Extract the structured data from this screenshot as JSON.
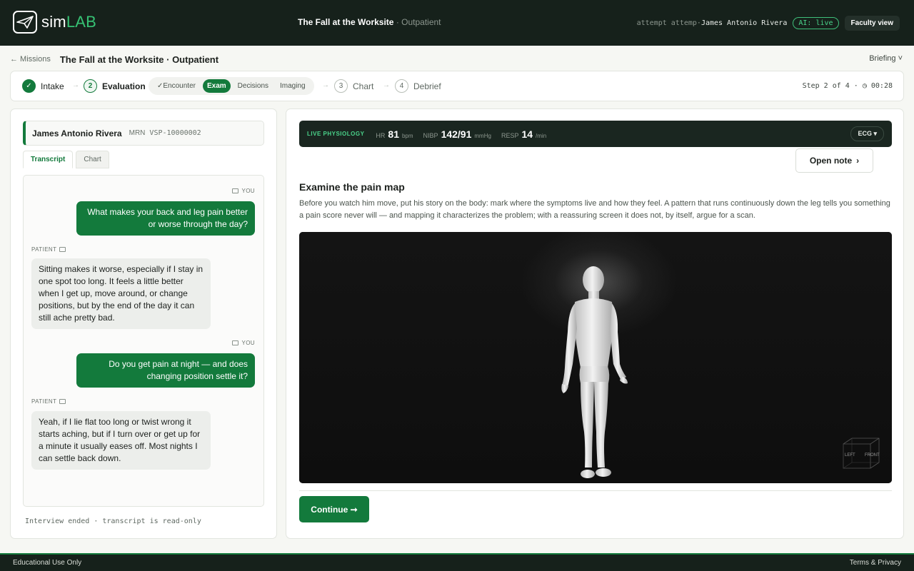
{
  "header": {
    "logo_text_a": "sim",
    "logo_text_b": "LAB",
    "mission_title": "The Fall at the Worksite",
    "mission_setting": " · Outpatient",
    "attempt_prefix": "attempt attemp·",
    "attempt_name": "James Antonio Rivera",
    "ai_badge": "AI: live",
    "faculty_button": "Faculty view"
  },
  "breadcrumb": {
    "back": "← Missions",
    "title": "The Fall at the Worksite · Outpatient",
    "briefing": "Briefing ˅"
  },
  "stepper": {
    "steps": [
      {
        "num": "✓",
        "label": "Intake",
        "state": "done"
      },
      {
        "num": "2",
        "label": "Evaluation",
        "state": "current"
      },
      {
        "num": "3",
        "label": "Chart",
        "state": "todo"
      },
      {
        "num": "4",
        "label": "Debrief",
        "state": "todo"
      }
    ],
    "arrow": "→",
    "subtabs": [
      "✓Encounter",
      "Exam",
      "Decisions",
      "Imaging"
    ],
    "active_subtab": "Exam",
    "step_info": "Step 2 of 4 · ◷ 00:28"
  },
  "patient": {
    "name": "James Antonio Rivera",
    "mrn_label": "MRN",
    "mrn": "VSP-10000002"
  },
  "left_tabs": [
    "Transcript",
    "Chart"
  ],
  "transcript": {
    "you_label": "YOU",
    "patient_label": "PATIENT",
    "messages": [
      {
        "speaker": "you",
        "text": "What makes your back and leg pain better or worse through the day?"
      },
      {
        "speaker": "patient",
        "text": "Sitting makes it worse, especially if I stay in one spot too long. It feels a little better when I get up, move around, or change positions, but by the end of the day it can still ache pretty bad."
      },
      {
        "speaker": "you",
        "text": "Do you get pain at night — and does changing position settle it?"
      },
      {
        "speaker": "patient",
        "text": "Yeah, if I lie flat too long or twist wrong it starts aching, but if I turn over or get up for a minute it usually eases off. Most nights I can settle back down."
      }
    ],
    "status": "Interview ended · transcript is read-only"
  },
  "vitals": {
    "live_label": "LIVE PHYSIOLOGY",
    "hr": {
      "label": "HR",
      "value": "81",
      "unit": "bpm"
    },
    "nibp": {
      "label": "NIBP",
      "value": "142/91",
      "unit": "mmHg"
    },
    "resp": {
      "label": "RESP",
      "value": "14",
      "unit": "/min"
    },
    "ecg_button": "ECG ▾"
  },
  "exam": {
    "open_note": "Open note",
    "open_note_chevron": "›",
    "title": "Examine the pain map",
    "description": "Before you watch him move, put his story on the body: mark where the symptoms live and how they feel. A pattern that runs continuously down the leg tells you something a pain score never will — and mapping it characterizes the problem; with a reassuring screen it does not, by itself, argue for a scan.",
    "cube_left": "LEFT",
    "cube_front": "FRONT",
    "continue": "Continue ➞"
  },
  "footer": {
    "left": "Educational Use Only",
    "right": "Terms & Privacy"
  }
}
